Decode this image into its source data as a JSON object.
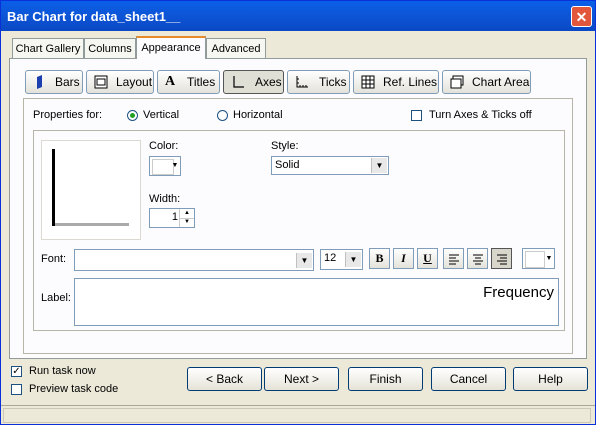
{
  "window": {
    "title": "Bar Chart for data_sheet1__",
    "close_icon": "close-icon"
  },
  "tabs": [
    {
      "label": "Chart Gallery"
    },
    {
      "label": "Columns"
    },
    {
      "label": "Appearance",
      "active": true
    },
    {
      "label": "Advanced"
    }
  ],
  "subtabs": [
    {
      "label": "Bars",
      "icon": "bars-icon"
    },
    {
      "label": "Layout",
      "icon": "layout-icon"
    },
    {
      "label": "Titles",
      "icon": "titles-icon"
    },
    {
      "label": "Axes",
      "icon": "axes-icon",
      "selected": true
    },
    {
      "label": "Ticks",
      "icon": "ticks-icon"
    },
    {
      "label": "Ref. Lines",
      "icon": "ref-lines-icon"
    },
    {
      "label": "Chart Area",
      "icon": "chart-area-icon"
    }
  ],
  "properties": {
    "label": "Properties for:",
    "vertical": "Vertical",
    "horizontal": "Horizontal",
    "selected": "Vertical",
    "turn_off": "Turn Axes & Ticks off",
    "turn_off_checked": false
  },
  "color": {
    "label": "Color:",
    "value": "#ffffff"
  },
  "style": {
    "label": "Style:",
    "value": "Solid"
  },
  "width": {
    "label": "Width:",
    "value": "1"
  },
  "font": {
    "label": "Font:",
    "value": "",
    "size": "12",
    "color": "#ffffff",
    "bold": "B",
    "italic": "I",
    "underline": "U"
  },
  "label_field": {
    "label": "Label:",
    "value": "Frequency"
  },
  "footer": {
    "run_task": "Run task now",
    "run_task_checked": true,
    "preview": "Preview task code",
    "preview_checked": false,
    "back": "< Back",
    "next": "Next >",
    "finish": "Finish",
    "cancel": "Cancel",
    "help": "Help"
  }
}
